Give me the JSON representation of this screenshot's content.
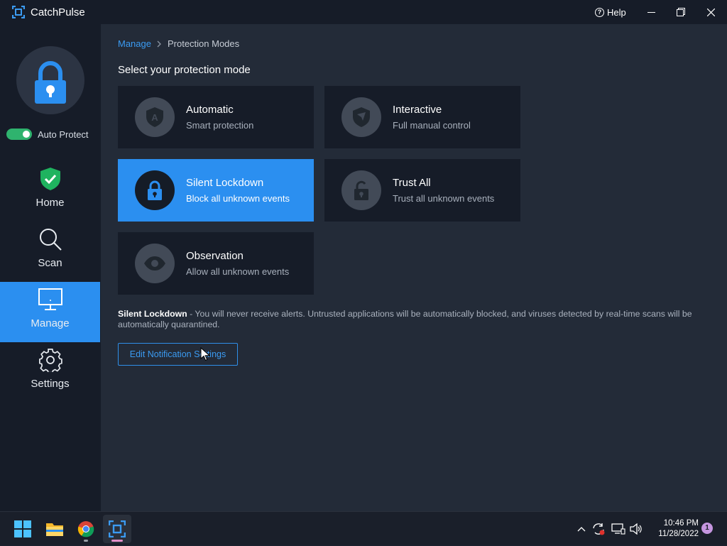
{
  "app": {
    "name": "CatchPulse"
  },
  "titlebar": {
    "help_label": "Help"
  },
  "sidebar": {
    "auto_protect_label": "Auto Protect",
    "auto_protect_on": true,
    "nav": [
      {
        "label": "Home",
        "icon": "shield-check-icon"
      },
      {
        "label": "Scan",
        "icon": "magnifier-icon"
      },
      {
        "label": "Manage",
        "icon": "monitor-icon",
        "active": true
      },
      {
        "label": "Settings",
        "icon": "gear-icon"
      }
    ]
  },
  "breadcrumb": {
    "parent": "Manage",
    "current": "Protection Modes"
  },
  "main": {
    "heading": "Select your protection mode",
    "modes": [
      {
        "title": "Automatic",
        "subtitle": "Smart protection",
        "icon": "shield-a-icon"
      },
      {
        "title": "Interactive",
        "subtitle": "Full manual control",
        "icon": "shield-cursor-icon"
      },
      {
        "title": "Silent Lockdown",
        "subtitle": "Block all unknown events",
        "icon": "lock-icon",
        "selected": true
      },
      {
        "title": "Trust All",
        "subtitle": "Trust all unknown events",
        "icon": "unlock-icon"
      },
      {
        "title": "Observation",
        "subtitle": "Allow all unknown events",
        "icon": "eye-icon"
      }
    ],
    "description_title": "Silent Lockdown",
    "description_text": " - You will never receive alerts. Untrusted applications will be automatically blocked, and viruses detected by real-time scans will be automatically quarantined.",
    "edit_button": "Edit Notification Settings"
  },
  "taskbar": {
    "apps": [
      "start-icon",
      "file-explorer-icon",
      "chrome-icon",
      "catchpulse-icon"
    ],
    "time": "10:46 PM",
    "date": "11/28/2022",
    "notification_count": "1"
  },
  "colors": {
    "accent": "#2b8ff0",
    "toggle_on": "#2fb36e",
    "shield_green": "#1fb35f"
  }
}
